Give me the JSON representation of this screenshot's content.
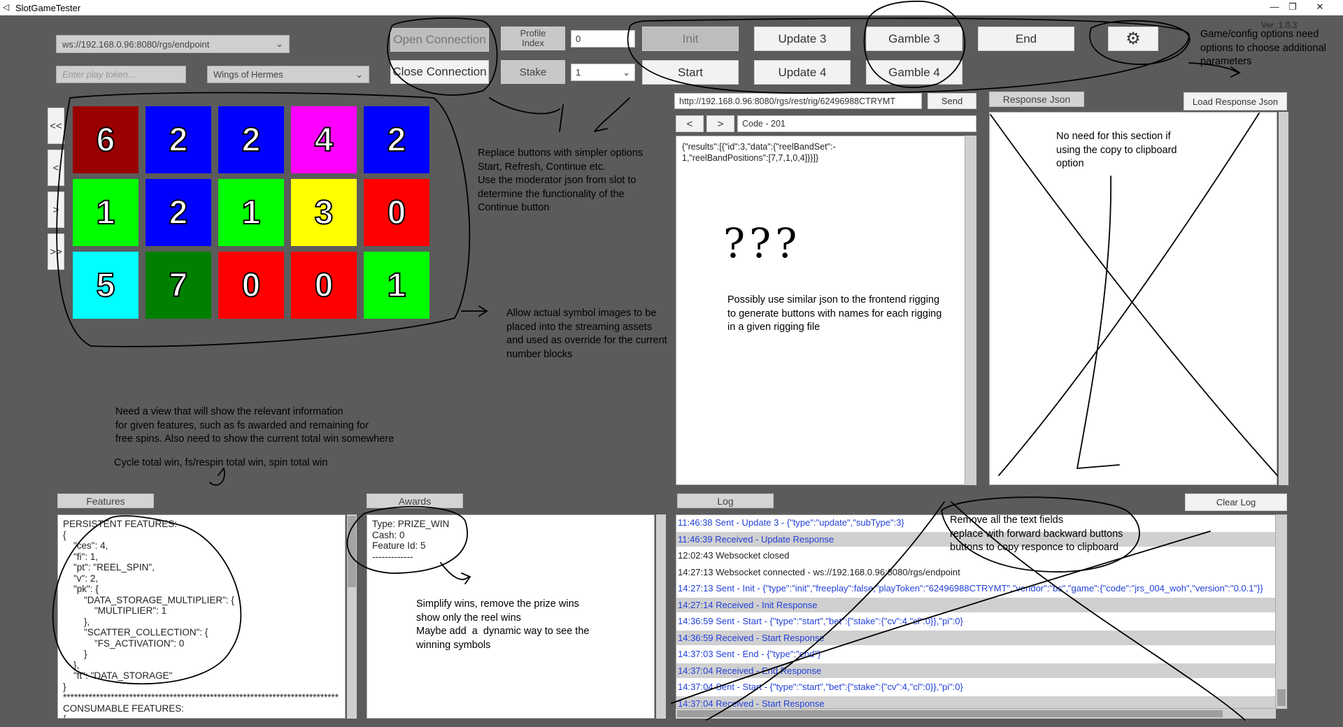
{
  "window": {
    "title": "SlotGameTester",
    "version": "Ver: 1.0.3"
  },
  "connection": {
    "endpoint": "ws://192.168.0.96:8080/rgs/endpoint",
    "token_placeholder": "Enter play token...",
    "game": "Wings of Hermes",
    "open_label": "Open Connection",
    "close_label": "Close Connection"
  },
  "controls": {
    "profile_index_label": "Profile\nIndex",
    "profile_index_value": "0",
    "stake_label": "Stake",
    "stake_value": "1",
    "init": "Init",
    "start": "Start",
    "update3": "Update 3",
    "update4": "Update 4",
    "gamble3": "Gamble 3",
    "gamble4": "Gamble 4",
    "end": "End"
  },
  "reel_nav": [
    "<<",
    "<",
    ">",
    ">>"
  ],
  "reels": {
    "grid": [
      [
        {
          "v": "6",
          "c": "#990000"
        },
        {
          "v": "2",
          "c": "#0000ff"
        },
        {
          "v": "2",
          "c": "#0000ff"
        },
        {
          "v": "4",
          "c": "#ff00ff"
        },
        {
          "v": "2",
          "c": "#0000ff"
        }
      ],
      [
        {
          "v": "1",
          "c": "#00ff00"
        },
        {
          "v": "2",
          "c": "#0000ff"
        },
        {
          "v": "1",
          "c": "#00ff00"
        },
        {
          "v": "3",
          "c": "#ffff00"
        },
        {
          "v": "0",
          "c": "#ff0000"
        }
      ],
      [
        {
          "v": "5",
          "c": "#00ffff"
        },
        {
          "v": "7",
          "c": "#008000"
        },
        {
          "v": "0",
          "c": "#ff0000"
        },
        {
          "v": "0",
          "c": "#ff0000"
        },
        {
          "v": "1",
          "c": "#00ff00"
        }
      ]
    ]
  },
  "rig": {
    "url": "http://192.168.0.96:8080/rgs/rest/rig/62496988CTRYMT",
    "send": "Send",
    "prev": "<",
    "next": ">",
    "code": "Code - 201",
    "request_json": "{\"results\":[{\"id\":3,\"data\":{\"reelBandSet\":-\n1,\"reelBandPositions\":[7,7,1,0,4]}}]}"
  },
  "response": {
    "tab": "Response Json",
    "load": "Load Response Json"
  },
  "features": {
    "tab": "Features",
    "text": "PERSISTENT FEATURES:\n{\n    \"ces\": 4,\n    \"fi\": 1,\n    \"pt\": \"REEL_SPIN\",\n    \"v\": 2,\n    \"pk\": {\n        \"DATA_STORAGE_MULTIPLIER\": {\n            \"MULTIPLIER\": 1\n        },\n        \"SCATTER_COLLECTION\": {\n            \"FS_ACTIVATION\": 0\n        }\n    },\n    \"ft\": \"DATA_STORAGE\"\n}\n***************************************************************************\nCONSUMABLE FEATURES:\n{"
  },
  "awards": {
    "tab": "Awards",
    "text": "Type: PRIZE_WIN\nCash: 0\nFeature Id: 5\n-------------"
  },
  "log": {
    "tab": "Log",
    "clear": "Clear Log",
    "rows": [
      {
        "text": "11:46:38 Sent - Update 3 - {\"type\":\"update\",\"subType\":3}",
        "color": "blue",
        "alt": false
      },
      {
        "text": "11:46:39 Received - Update Response",
        "color": "blue",
        "alt": true
      },
      {
        "text": "12:02:43 Websocket closed",
        "color": "black",
        "alt": false
      },
      {
        "text": "14:27:13 Websocket connected - ws://192.168.0.96:8080/rgs/endpoint",
        "color": "black",
        "alt": false
      },
      {
        "text": "14:27:13 Sent - Init - {\"type\":\"init\",\"freeplay\":false,\"playToken\":\"62496988CTRYMT\",\"vendor\":\"bs\",\"game\":{\"code\":\"jrs_004_woh\",\"version\":\"0.0.1\"}}",
        "color": "blue",
        "alt": false
      },
      {
        "text": "14:27:14 Received - Init Response",
        "color": "blue",
        "alt": true
      },
      {
        "text": "14:36:59 Sent - Start - {\"type\":\"start\",\"bet\":{\"stake\":{\"cv\":4,\"cl\":0}},\"pi\":0}",
        "color": "blue",
        "alt": false
      },
      {
        "text": "14:36:59 Received - Start Response",
        "color": "blue",
        "alt": true
      },
      {
        "text": "14:37:03 Sent - End  - {\"type\":\"end\"}",
        "color": "blue",
        "alt": false
      },
      {
        "text": "14:37:04 Received - End Response",
        "color": "blue",
        "alt": true
      },
      {
        "text": "14:37:04 Sent - Start - {\"type\":\"start\",\"bet\":{\"stake\":{\"cv\":4,\"cl\":0}},\"pi\":0}",
        "color": "blue",
        "alt": false
      },
      {
        "text": "14:37:04 Received - Start Response",
        "color": "blue",
        "alt": true
      }
    ]
  },
  "annotations": {
    "config": "Game/config options need\noptions to choose additional\nparameters",
    "buttons": "Replace buttons with simpler options\nStart, Refresh, Continue etc.\nUse the moderator json from slot to\ndetermine the functionality of the\nContinue button",
    "symbols": "Allow actual symbol images to be\nplaced into the streaming assets\nand used as override for the current\nnumber blocks",
    "features_view": "Need a view that will show the relevant information\nfor given features, such as fs awarded and remaining for\nfree spins. Also need to show the current total win somewhere",
    "cycle": "Cycle total win, fs/respin total win, spin total win",
    "rigging": "Possibly use similar json to the frontend rigging\nto generate buttons with names for each rigging\nin a given rigging file",
    "question": "???",
    "response_note": "No need for this section if\nusing the copy to clipboard\noption",
    "wins": "Simplify wins, remove the prize wins\nshow only the reel wins\nMaybe add  a  dynamic way to see the\nwinning symbols",
    "log_note": "Remove all the text fields\nreplace with forward backward buttons\nbuttons to copy responce to clipboard"
  }
}
